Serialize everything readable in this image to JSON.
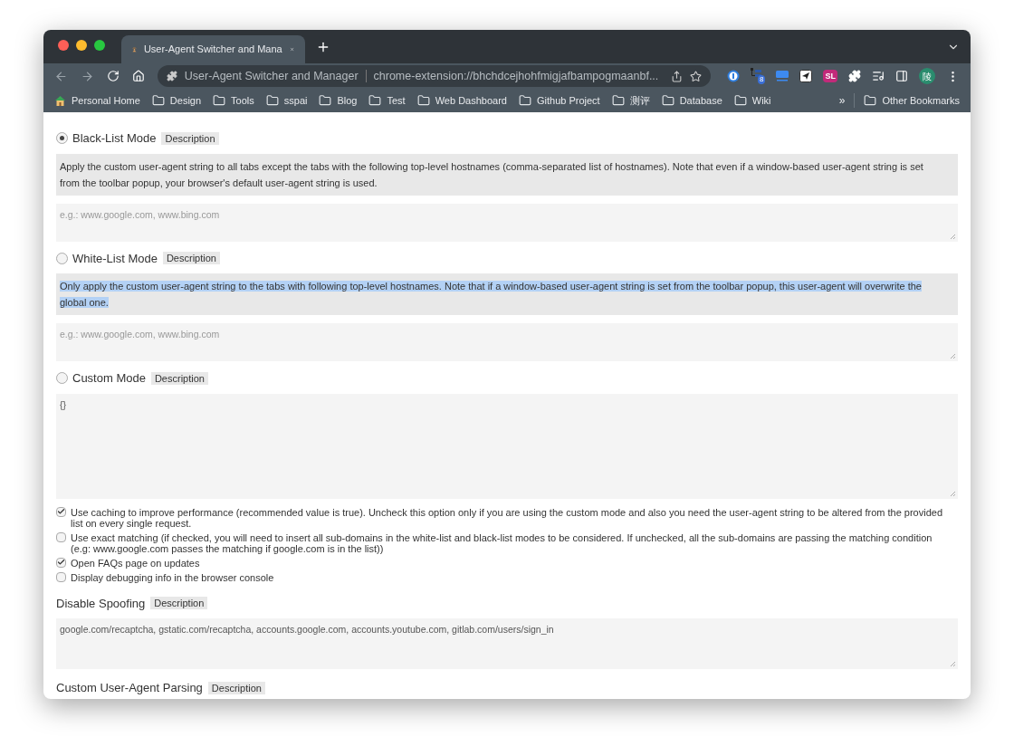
{
  "tab": {
    "title": "User-Agent Switcher and Mana"
  },
  "address_bar": {
    "site": "User-Agent Switcher and Manager",
    "url": "chrome-extension://bhchdcejhohfmigjafbampogmaanbf..."
  },
  "extensions": {
    "badge": "8",
    "sl_label": "SL",
    "avatar": "陵"
  },
  "bookmarks": [
    {
      "kind": "home",
      "label": "Personal Home"
    },
    {
      "kind": "folder",
      "label": "Design"
    },
    {
      "kind": "folder",
      "label": "Tools"
    },
    {
      "kind": "folder",
      "label": "sspai"
    },
    {
      "kind": "folder",
      "label": "Blog"
    },
    {
      "kind": "folder",
      "label": "Test"
    },
    {
      "kind": "folder",
      "label": "Web Dashboard"
    },
    {
      "kind": "folder",
      "label": "Github Project"
    },
    {
      "kind": "folder",
      "label": "测评"
    },
    {
      "kind": "folder",
      "label": "Database"
    },
    {
      "kind": "folder",
      "label": "Wiki"
    }
  ],
  "bookmarks_overflow": "»",
  "other_bookmarks": "Other Bookmarks",
  "modes": [
    {
      "label": "Black-List Mode",
      "selected": true,
      "tag": "Description",
      "description": "Apply the custom user-agent string to all tabs except the tabs with the following top-level hostnames (comma-separated list of hostnames). Note that even if a window-based user-agent string is set from the toolbar popup, your browser's default user-agent string is used.",
      "highlighted": false,
      "field": {
        "placeholder": "e.g.: www.google.com, www.bing.com"
      }
    },
    {
      "label": "White-List Mode",
      "selected": false,
      "tag": "Description",
      "description": "Only apply the custom user-agent string to the tabs with following top-level hostnames. Note that if a window-based user-agent string is set from the toolbar popup, this user-agent will overwrite the global one.",
      "highlighted": true,
      "field": {
        "placeholder": "e.g.: www.google.com, www.bing.com"
      }
    },
    {
      "label": "Custom Mode",
      "selected": false,
      "tag": "Description",
      "field": {
        "value": "{}"
      }
    }
  ],
  "options": [
    {
      "label": "Use caching to improve performance (recommended value is true). Uncheck this option only if you are using the custom mode and also you need the user-agent string to be altered from the provided list on every single request.",
      "checked": true
    },
    {
      "label": "Use exact matching (if checked, you will need to insert all sub-domains in the white-list and black-list modes to be considered. If unchecked, all the sub-domains are passing the matching condition (e.g: www.google.com passes the matching if google.com is in the list))",
      "checked": false
    },
    {
      "label": "Open FAQs page on updates",
      "checked": true
    },
    {
      "label": "Display debugging info in the browser console",
      "checked": false
    }
  ],
  "sections": [
    {
      "label": "Disable Spoofing",
      "tag": "Description",
      "value": "google.com/recaptcha, gstatic.com/recaptcha, accounts.google.com, accounts.youtube.com, gitlab.com/users/sign_in"
    },
    {
      "label": "Custom User-Agent Parsing",
      "tag": "Description"
    }
  ]
}
